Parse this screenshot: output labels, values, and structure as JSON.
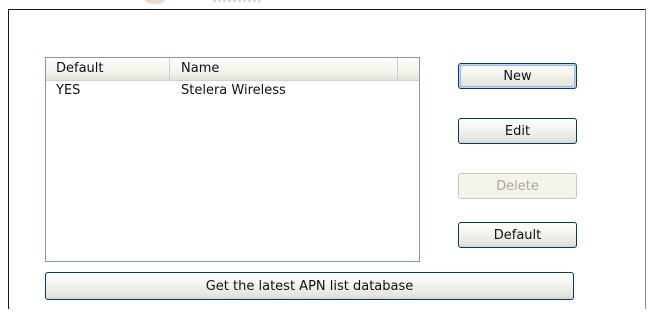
{
  "apn_list": {
    "columns": [
      "Default",
      "Name"
    ],
    "rows": [
      {
        "default": "YES",
        "name": "Stelera Wireless"
      }
    ]
  },
  "buttons": {
    "new_label": "New",
    "edit_label": "Edit",
    "delete_label": "Delete",
    "default_label": "Default",
    "latest_label": "Get the latest APN list database"
  },
  "state": {
    "delete_enabled": false
  }
}
